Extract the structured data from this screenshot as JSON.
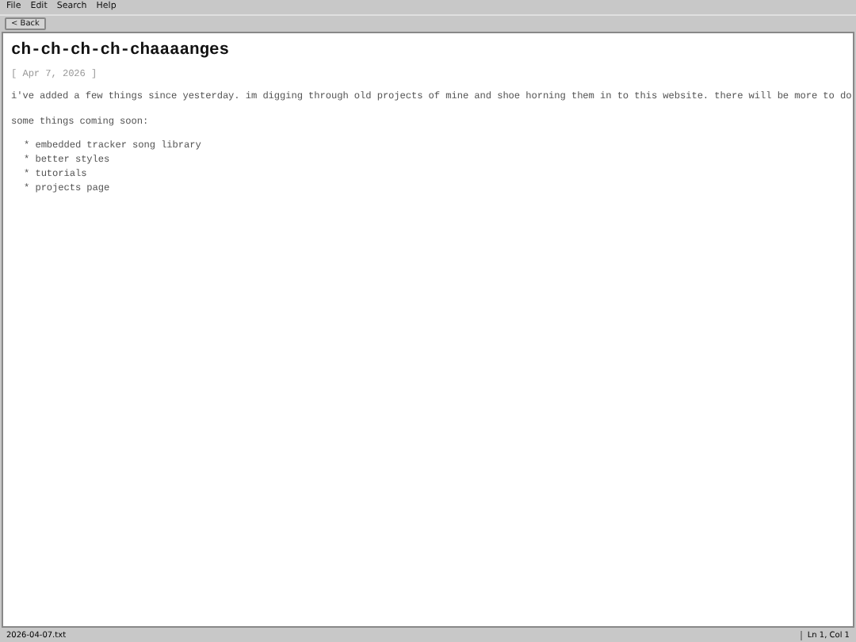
{
  "menu": [
    "File",
    "Edit",
    "Search",
    "Help"
  ],
  "toolbar": {
    "back_button": "< Back"
  },
  "document": {
    "title": "ch-ch-ch-ch-chaaaanges",
    "date": "[ Apr 7, 2026 ]",
    "paragraphs": [
      "i've added a few things since yesterday. im digging through old projects of mine and shoe horning them in to this website. there will be more to do",
      "some things coming soon:"
    ],
    "list": [
      "* embedded tracker song library",
      "* better styles",
      "* tutorials",
      "* projects page"
    ]
  },
  "status_bar": {
    "file": "2026-04-07.txt",
    "position": "Ln 1, Col 1"
  }
}
